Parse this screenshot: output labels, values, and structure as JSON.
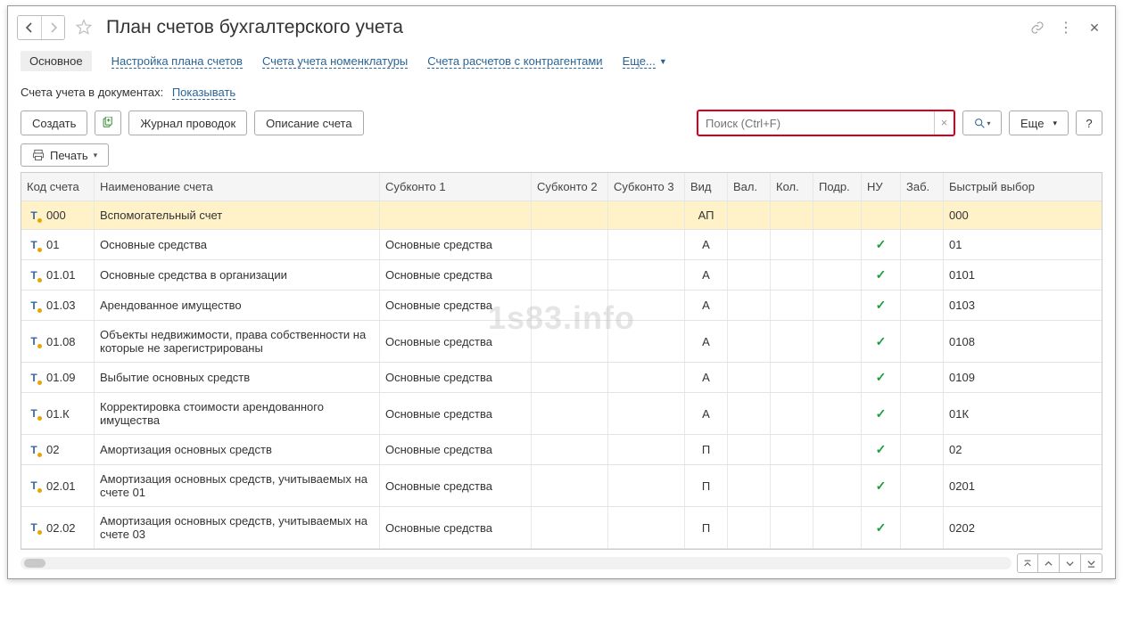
{
  "title": "План счетов бухгалтерского учета",
  "tabs": {
    "active": "Основное",
    "items": [
      "Настройка плана счетов",
      "Счета учета номенклатуры",
      "Счета расчетов с контрагентами"
    ],
    "more": "Еще..."
  },
  "subline": {
    "label": "Счета учета в документах:",
    "link": "Показывать"
  },
  "toolbar": {
    "create": "Создать",
    "journal": "Журнал проводок",
    "describe": "Описание счета",
    "search_placeholder": "Поиск (Ctrl+F)",
    "more": "Еще",
    "help": "?",
    "print": "Печать"
  },
  "columns": {
    "code": "Код счета",
    "name": "Наименование счета",
    "sk1": "Субконто 1",
    "sk2": "Субконто 2",
    "sk3": "Субконто 3",
    "vid": "Вид",
    "val": "Вал.",
    "kol": "Кол.",
    "podr": "Подр.",
    "nu": "НУ",
    "zab": "Заб.",
    "fast": "Быстрый выбор"
  },
  "rows": [
    {
      "code": "000",
      "name": "Вспомогательный счет",
      "sk1": "",
      "vid": "АП",
      "nu": false,
      "fast": "000",
      "sel": true
    },
    {
      "code": "01",
      "name": "Основные средства",
      "sk1": "Основные средства",
      "vid": "А",
      "nu": true,
      "fast": "01"
    },
    {
      "code": "01.01",
      "name": "Основные средства в организации",
      "sk1": "Основные средства",
      "vid": "А",
      "nu": true,
      "fast": "0101"
    },
    {
      "code": "01.03",
      "name": "Арендованное имущество",
      "sk1": "Основные средства",
      "vid": "А",
      "nu": true,
      "fast": "0103"
    },
    {
      "code": "01.08",
      "name": "Объекты недвижимости, права собственности на которые не зарегистрированы",
      "sk1": "Основные средства",
      "vid": "А",
      "nu": true,
      "fast": "0108"
    },
    {
      "code": "01.09",
      "name": "Выбытие основных средств",
      "sk1": "Основные средства",
      "vid": "А",
      "nu": true,
      "fast": "0109"
    },
    {
      "code": "01.К",
      "name": "Корректировка стоимости арендованного имущества",
      "sk1": "Основные средства",
      "vid": "А",
      "nu": true,
      "fast": "01К"
    },
    {
      "code": "02",
      "name": "Амортизация основных средств",
      "sk1": "Основные средства",
      "vid": "П",
      "nu": true,
      "fast": "02"
    },
    {
      "code": "02.01",
      "name": "Амортизация основных средств, учитываемых на счете 01",
      "sk1": "Основные средства",
      "vid": "П",
      "nu": true,
      "fast": "0201"
    },
    {
      "code": "02.02",
      "name": "Амортизация основных средств, учитываемых на счете 03",
      "sk1": "Основные средства",
      "vid": "П",
      "nu": true,
      "fast": "0202"
    }
  ],
  "watermark": "1s83.info"
}
